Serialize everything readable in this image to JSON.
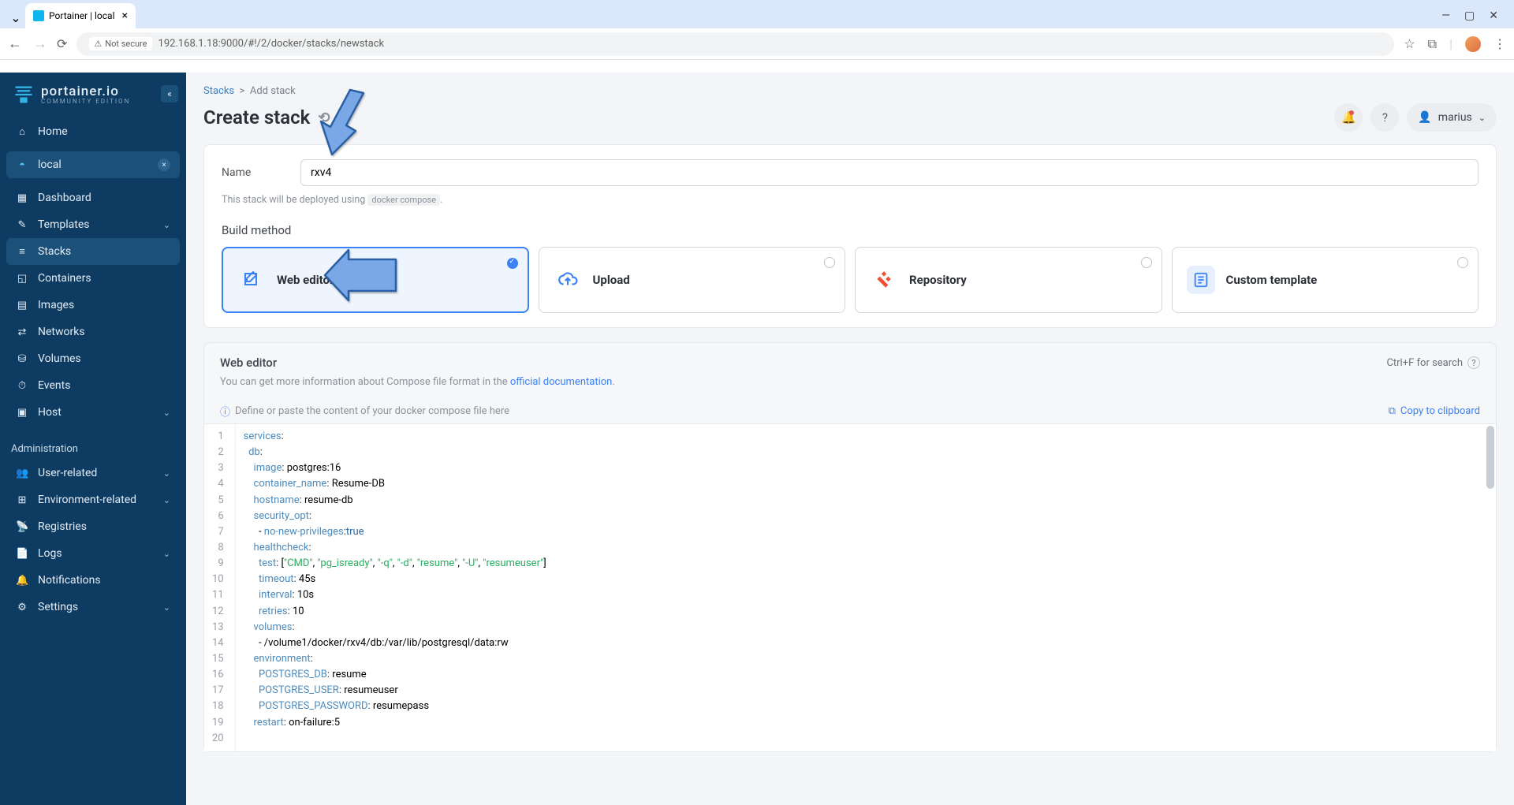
{
  "browser": {
    "tab_title": "Portainer | local",
    "not_secure": "Not secure",
    "url": "192.168.1.18:9000/#!/2/docker/stacks/newstack"
  },
  "brand": {
    "name": "portainer.io",
    "edition": "COMMUNITY EDITION"
  },
  "user": {
    "name": "marius"
  },
  "breadcrumb": {
    "root": "Stacks",
    "current": "Add stack"
  },
  "page": {
    "title": "Create stack",
    "name_label": "Name",
    "name_value": "rxv4",
    "deploy_hint_prefix": "This stack will be deployed using ",
    "deploy_hint_code": "docker compose",
    "deploy_hint_suffix": ".",
    "build_method_title": "Build method"
  },
  "methods": [
    {
      "id": "web-editor",
      "label": "Web editor",
      "selected": true
    },
    {
      "id": "upload",
      "label": "Upload",
      "selected": false
    },
    {
      "id": "repository",
      "label": "Repository",
      "selected": false
    },
    {
      "id": "custom-template",
      "label": "Custom template",
      "selected": false
    }
  ],
  "editor": {
    "title": "Web editor",
    "shortcut": "Ctrl+F for search",
    "hint_prefix": "You can get more information about Compose file format in the ",
    "hint_link": "official documentation",
    "hint_suffix": ".",
    "placeholder": "Define or paste the content of your docker compose file here",
    "copy_label": "Copy to clipboard",
    "lines": [
      "services:",
      "  db:",
      "    image: postgres:16",
      "    container_name: Resume-DB",
      "    hostname: resume-db",
      "    security_opt:",
      "      - no-new-privileges:true",
      "    healthcheck:",
      "      test: [\"CMD\", \"pg_isready\", \"-q\", \"-d\", \"resume\", \"-U\", \"resumeuser\"]",
      "      timeout: 45s",
      "      interval: 10s",
      "      retries: 10",
      "    volumes:",
      "      - /volume1/docker/rxv4/db:/var/lib/postgresql/data:rw",
      "    environment:",
      "      POSTGRES_DB: resume",
      "      POSTGRES_USER: resumeuser",
      "      POSTGRES_PASSWORD: resumepass",
      "    restart: on-failure:5",
      ""
    ]
  },
  "sidebar": {
    "home": "Home",
    "env": "local",
    "items": [
      {
        "icon": "dashboard",
        "label": "Dashboard"
      },
      {
        "icon": "templates",
        "label": "Templates",
        "chev": true
      },
      {
        "icon": "stacks",
        "label": "Stacks",
        "active": true
      },
      {
        "icon": "containers",
        "label": "Containers"
      },
      {
        "icon": "images",
        "label": "Images"
      },
      {
        "icon": "networks",
        "label": "Networks"
      },
      {
        "icon": "volumes",
        "label": "Volumes"
      },
      {
        "icon": "events",
        "label": "Events"
      },
      {
        "icon": "host",
        "label": "Host",
        "chev": true
      }
    ],
    "admin_label": "Administration",
    "admin_items": [
      {
        "icon": "users",
        "label": "User-related",
        "chev": true
      },
      {
        "icon": "env",
        "label": "Environment-related",
        "chev": true
      },
      {
        "icon": "registries",
        "label": "Registries"
      },
      {
        "icon": "logs",
        "label": "Logs",
        "chev": true
      },
      {
        "icon": "notifications",
        "label": "Notifications"
      },
      {
        "icon": "settings",
        "label": "Settings",
        "chev": true
      }
    ]
  }
}
